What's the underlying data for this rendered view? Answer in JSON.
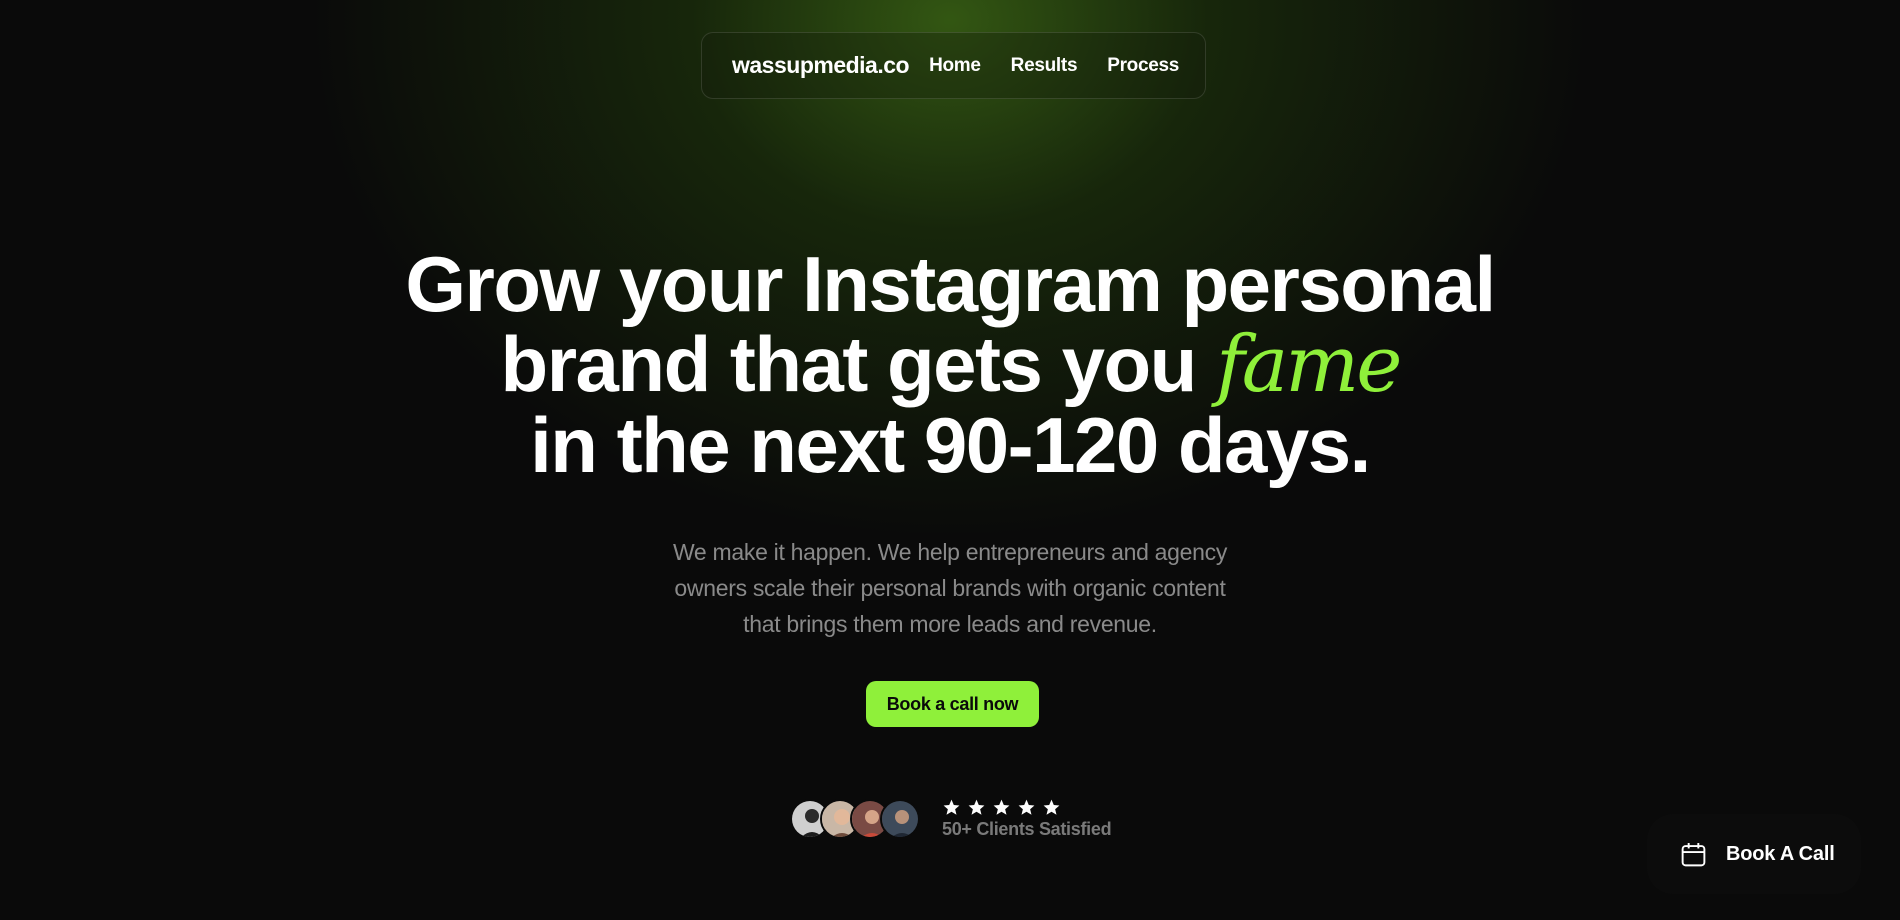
{
  "nav": {
    "brand": "wassupmedia.co",
    "links": [
      "Home",
      "Results",
      "Process"
    ]
  },
  "hero": {
    "headline_lines": [
      "Grow your Instagram personal",
      "brand that gets you ",
      "in the next 90-120 days."
    ],
    "accent_word": "fame",
    "subtitle_lines": [
      "We make it happen. We help entrepreneurs and agency",
      "owners scale their personal brands with organic content",
      "that brings them more leads and revenue."
    ],
    "cta_label": "Book a call now"
  },
  "social_proof": {
    "rating_stars": 5,
    "label": "50+ Clients Satisfied",
    "avatar_count": 4
  },
  "floating_button": {
    "label": "Book A Call",
    "icon": "calendar-icon"
  },
  "colors": {
    "accent": "#8ff03a",
    "background": "#0a0a0a",
    "glow": "#3a6414",
    "subtitle": "#8a8a8a"
  }
}
